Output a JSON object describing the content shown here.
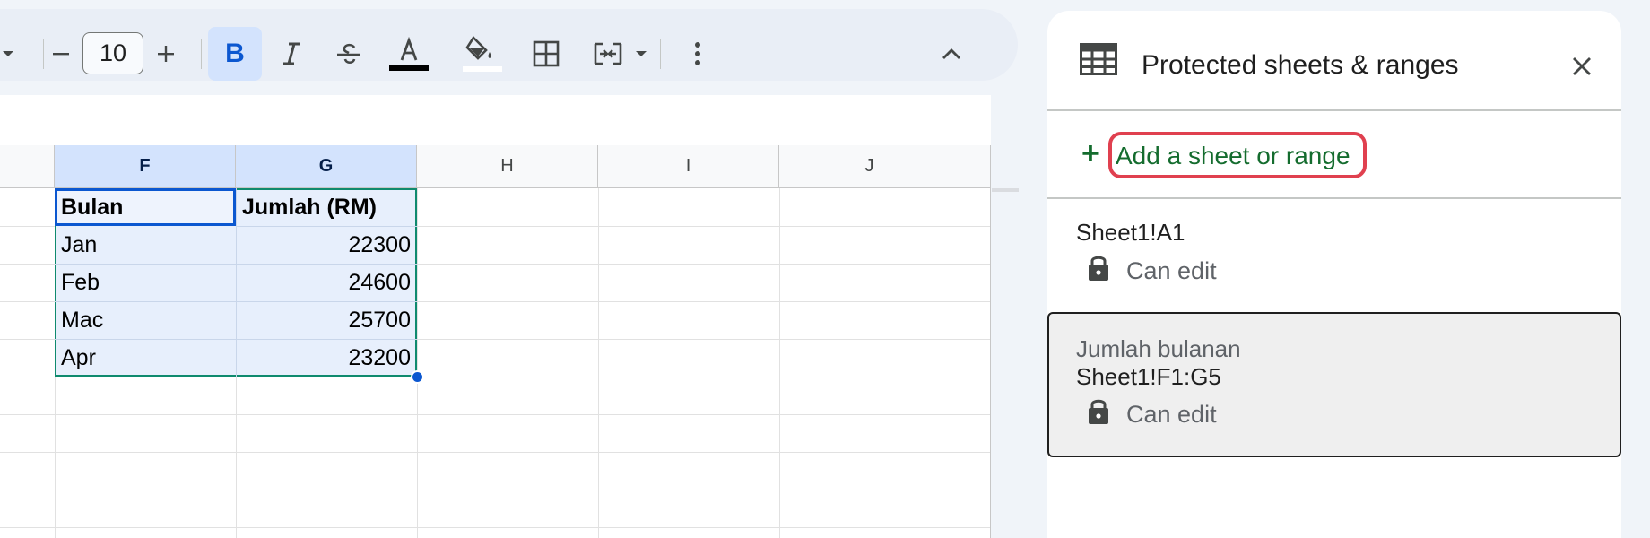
{
  "toolbar": {
    "font_size": "10",
    "bold_label": "B"
  },
  "grid": {
    "columns": [
      "F",
      "G",
      "H",
      "I",
      "J"
    ],
    "rows": [
      [
        "Bulan",
        "Jumlah (RM)"
      ],
      [
        "Jan",
        "22300"
      ],
      [
        "Feb",
        "24600"
      ],
      [
        "Mac",
        "25700"
      ],
      [
        "Apr",
        "23200"
      ]
    ]
  },
  "panel": {
    "title": "Protected sheets & ranges",
    "add_label": "Add a sheet or range",
    "add_plus": "+",
    "items": [
      {
        "range": "Sheet1!A1",
        "permission": "Can edit"
      },
      {
        "description": "Jumlah bulanan",
        "range": "Sheet1!F1:G5",
        "permission": "Can edit"
      }
    ]
  },
  "colors": {
    "accent_green": "#146c2e",
    "highlight_red": "#e0404f",
    "selection_blue": "#0b57d0"
  }
}
